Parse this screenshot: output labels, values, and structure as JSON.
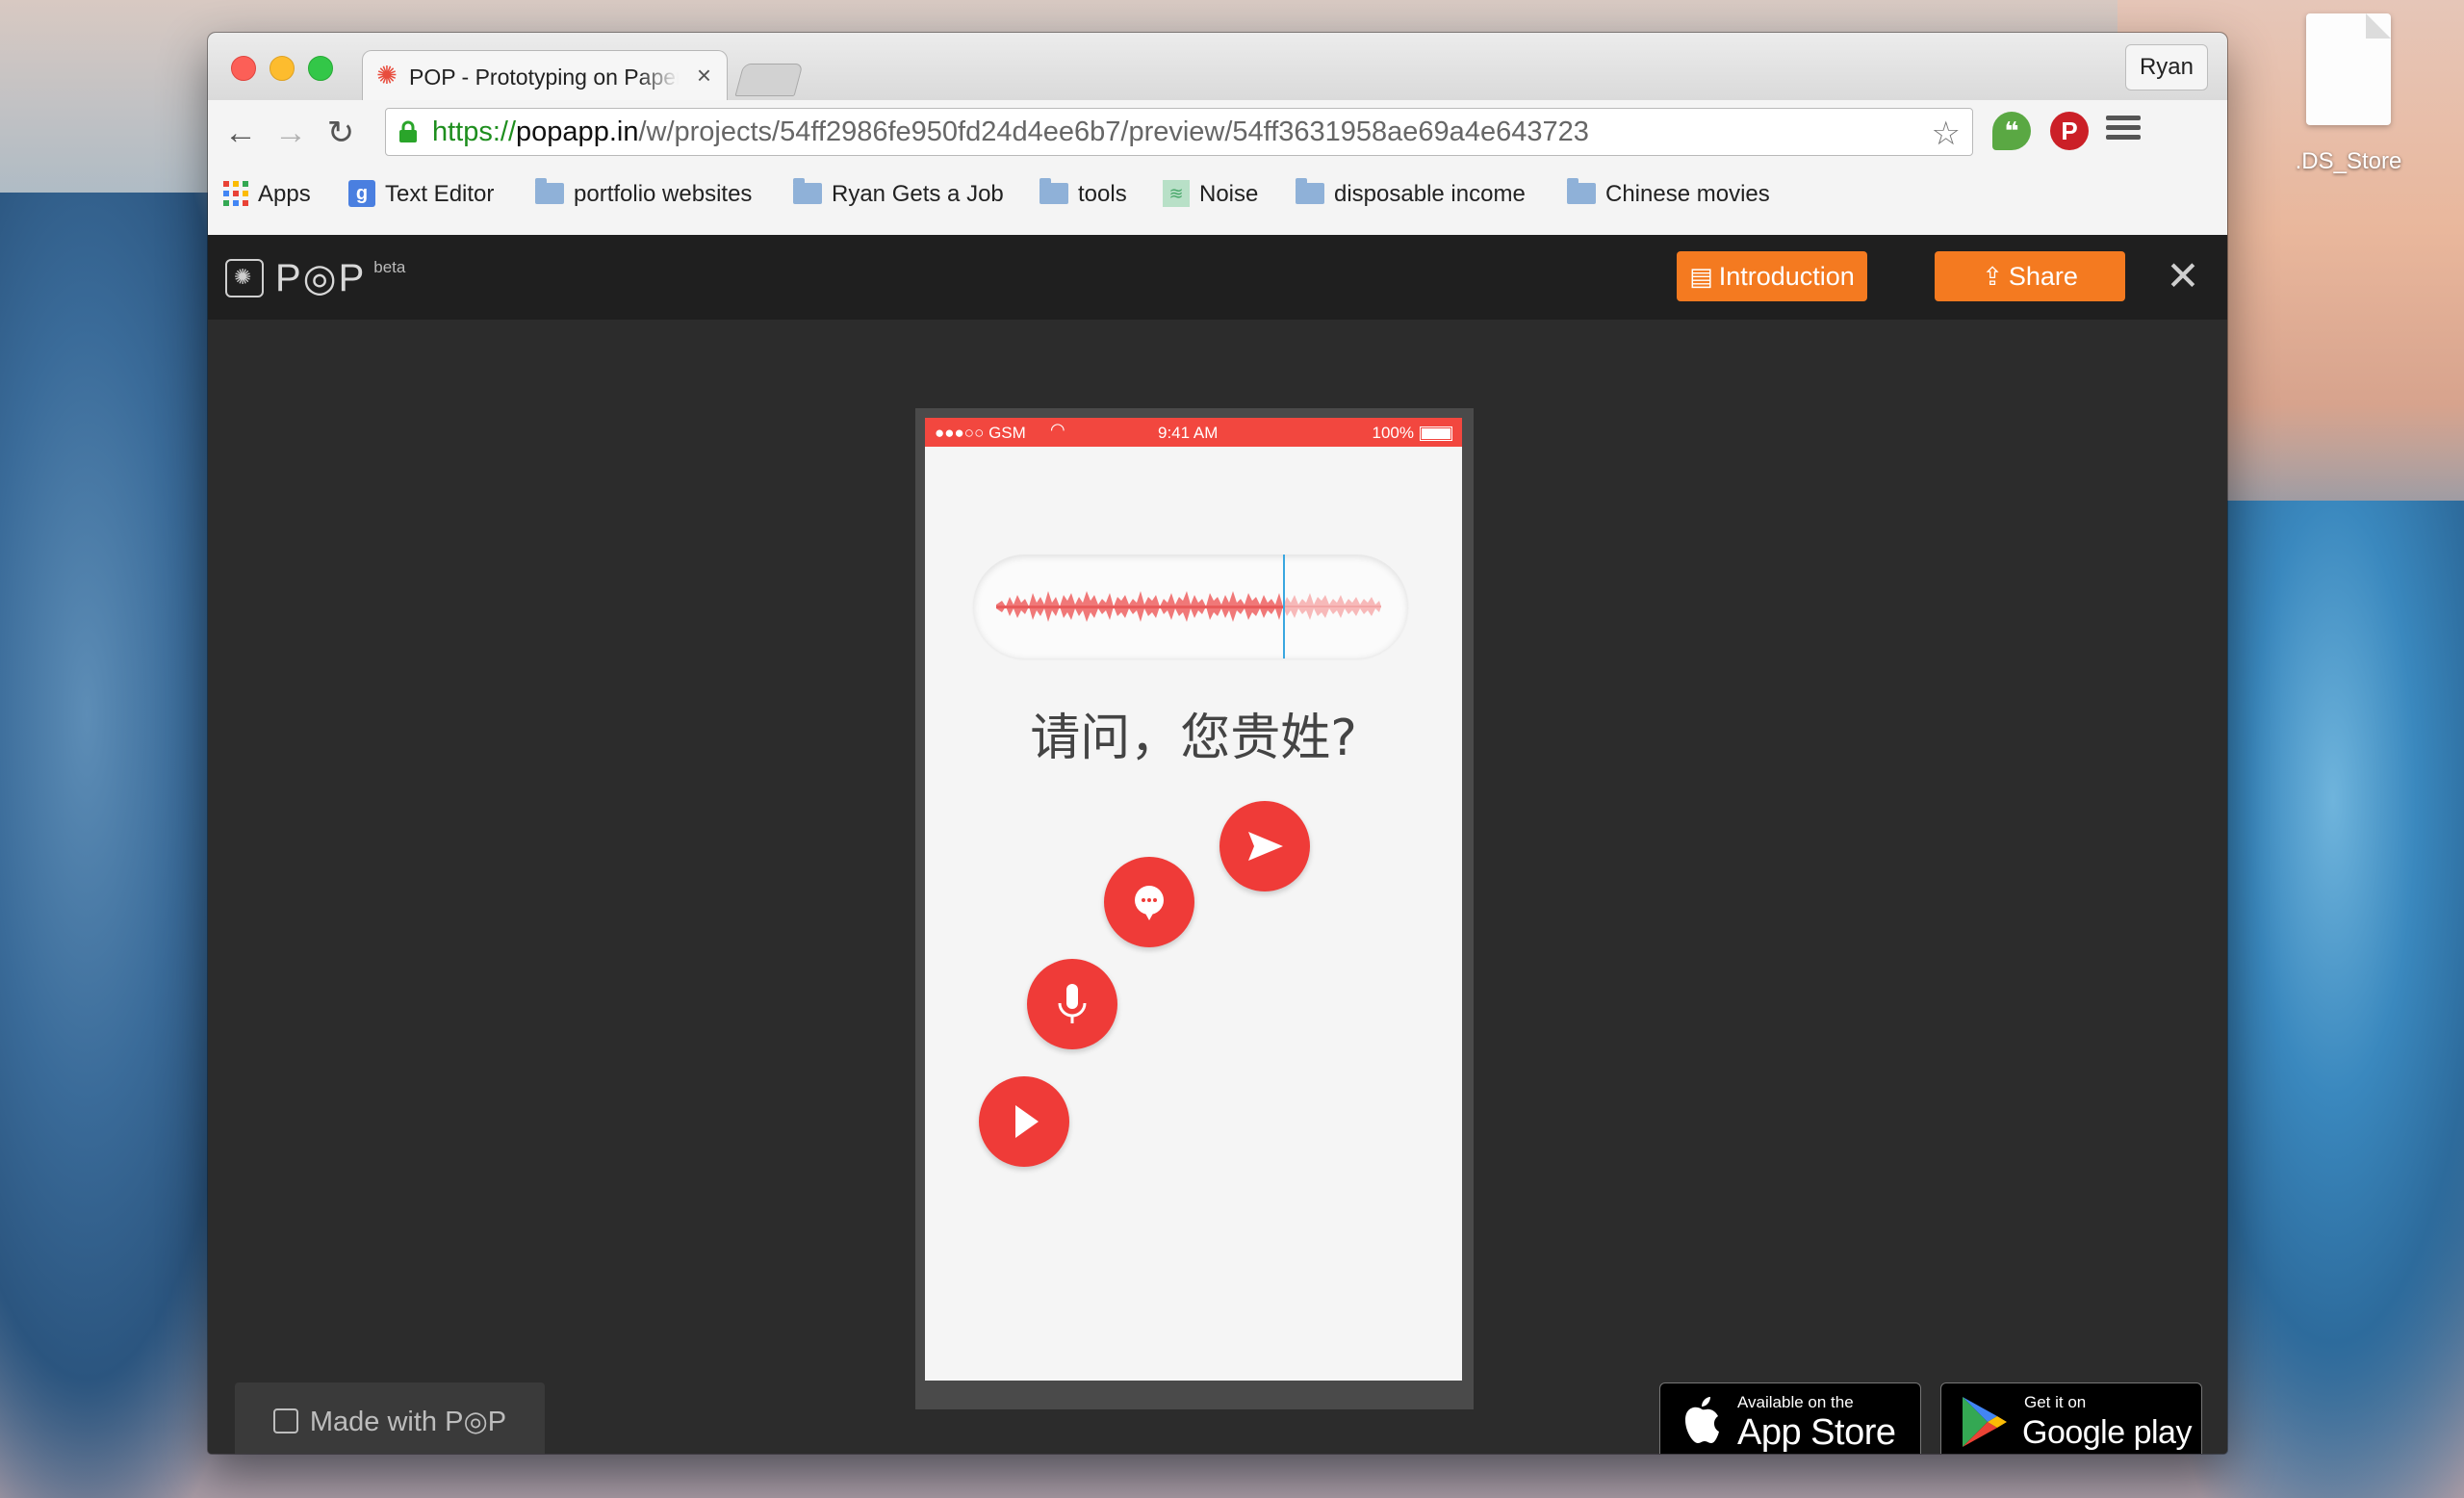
{
  "desktop": {
    "file_label": ".DS_Store"
  },
  "browser": {
    "tab_title": "POP - Prototyping on Paper",
    "user_button": "Ryan",
    "url": {
      "scheme": "https://",
      "host": "popapp.in",
      "path": "/w/projects/54ff2986fe950fd24d4ee6b7/preview/54ff3631958ae69a4e643723"
    },
    "bookmarks": [
      {
        "label": "Apps",
        "icon": "apps-grid-icon"
      },
      {
        "label": "Text Editor",
        "icon": "google-g-icon"
      },
      {
        "label": "portfolio websites",
        "icon": "folder-icon"
      },
      {
        "label": "Ryan Gets a Job",
        "icon": "folder-icon"
      },
      {
        "label": "tools",
        "icon": "folder-icon"
      },
      {
        "label": "Noise",
        "icon": "noise-icon"
      },
      {
        "label": "disposable income",
        "icon": "folder-icon"
      },
      {
        "label": "Chinese movies",
        "icon": "folder-icon"
      }
    ]
  },
  "pop": {
    "logo_text": "P◎P",
    "beta": "beta",
    "introduction_button": "Introduction",
    "share_button": "Share",
    "made_with": "Made with P◎P",
    "appstore_small": "Available on the",
    "appstore_big": "App Store",
    "play_small": "Get it on",
    "play_big": "Google play"
  },
  "phone": {
    "carrier": "●●●○○ GSM",
    "time": "9:41 AM",
    "battery": "100%",
    "prompt": "请问，您贵姓?",
    "buttons": [
      "send-icon",
      "chat-icon",
      "mic-icon",
      "play-icon"
    ]
  },
  "colors": {
    "accent_orange": "#f47a20",
    "status_red": "#f2473f",
    "fab_red": "#ef3b38",
    "playhead_blue": "#3aa7e0"
  }
}
